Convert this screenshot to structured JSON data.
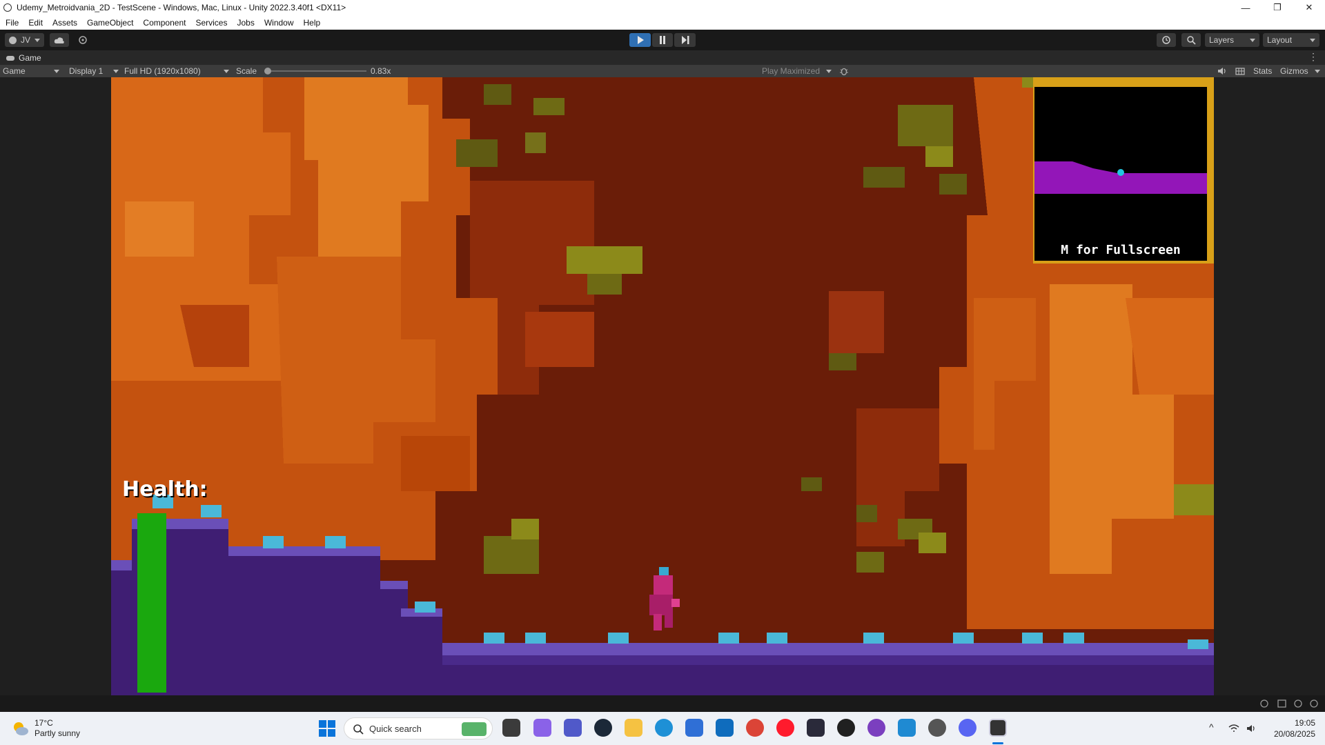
{
  "window": {
    "title": "Udemy_Metroidvania_2D - TestScene - Windows, Mac, Linux - Unity 2022.3.40f1 <DX11>",
    "controls": [
      "—",
      "❐",
      "✕"
    ]
  },
  "menu": [
    "File",
    "Edit",
    "Assets",
    "GameObject",
    "Component",
    "Services",
    "Jobs",
    "Window",
    "Help"
  ],
  "toolbar": {
    "account_label": "JV",
    "layers_label": "Layers",
    "layout_label": "Layout"
  },
  "game_tab": {
    "label": "Game"
  },
  "game_bar": {
    "view_select": "Game",
    "display_select": "Display 1",
    "resolution_select": "Full HD (1920x1080)",
    "scale_label": "Scale",
    "scale_value": "0.83x",
    "scale_fraction": 0.0,
    "play_mode_select": "Play Maximized",
    "stats_label": "Stats",
    "gizmos_label": "Gizmos"
  },
  "game": {
    "health_label": "Health:",
    "health_fraction": 1.0,
    "health_color": "#1aa80e",
    "minimap_hint": "M for Fullscreen",
    "minimap_floor_color": "#9316b8",
    "minimap_player_color": "#22c7e0"
  },
  "taskbar": {
    "weather_temp": "17°C",
    "weather_desc": "Partly sunny",
    "search_placeholder": "Quick search",
    "time": "19:05",
    "date": "20/08/2025"
  }
}
